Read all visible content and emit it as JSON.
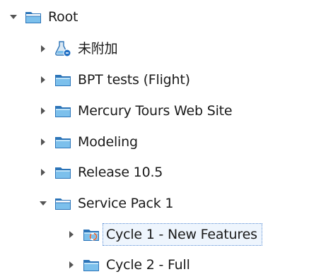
{
  "tree": {
    "root": {
      "label": "Root",
      "expanded": true,
      "icon": "folder-open-icon"
    },
    "children": [
      {
        "label": "未附加",
        "icon": "unattached-flask-icon",
        "expanded": false
      },
      {
        "label": "BPT tests (Flight)",
        "icon": "folder-icon",
        "expanded": false
      },
      {
        "label": "Mercury Tours Web Site",
        "icon": "folder-icon",
        "expanded": false
      },
      {
        "label": "Modeling",
        "icon": "folder-icon",
        "expanded": false
      },
      {
        "label": "Release 10.5",
        "icon": "folder-icon",
        "expanded": false
      },
      {
        "label": "Service Pack 1",
        "icon": "folder-open-icon",
        "expanded": true,
        "children": [
          {
            "label": "Cycle 1 - New Features",
            "icon": "cycle-folder-icon",
            "expanded": false,
            "selected": true
          },
          {
            "label": "Cycle 2 - Full",
            "icon": "cycle-folder-icon",
            "expanded": false
          }
        ]
      }
    ]
  },
  "colors": {
    "folder_fill": "#7cc0ec",
    "folder_dark": "#2c74b8",
    "selection_border": "#5b8fd6",
    "selection_fill": "#eef5fd",
    "arrow": "#555555"
  }
}
